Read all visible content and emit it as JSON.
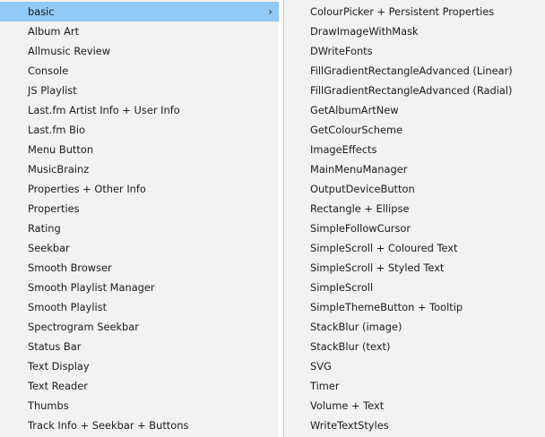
{
  "left_menu": {
    "items": [
      {
        "label": "basic",
        "has_submenu": true,
        "arrow": "›"
      },
      {
        "label": "Album Art"
      },
      {
        "label": "Allmusic Review"
      },
      {
        "label": "Console"
      },
      {
        "label": "JS Playlist"
      },
      {
        "label": "Last.fm Artist Info + User Info"
      },
      {
        "label": "Last.fm Bio"
      },
      {
        "label": "Menu Button"
      },
      {
        "label": "MusicBrainz"
      },
      {
        "label": "Properties + Other Info"
      },
      {
        "label": "Properties"
      },
      {
        "label": "Rating"
      },
      {
        "label": "Seekbar"
      },
      {
        "label": "Smooth Browser"
      },
      {
        "label": "Smooth Playlist Manager"
      },
      {
        "label": "Smooth Playlist"
      },
      {
        "label": "Spectrogram Seekbar"
      },
      {
        "label": "Status Bar"
      },
      {
        "label": "Text Display"
      },
      {
        "label": "Text Reader"
      },
      {
        "label": "Thumbs"
      },
      {
        "label": "Track Info + Seekbar + Buttons"
      }
    ],
    "selected_index": 0
  },
  "right_menu": {
    "items": [
      {
        "label": "ColourPicker + Persistent Properties"
      },
      {
        "label": "DrawImageWithMask"
      },
      {
        "label": "DWriteFonts"
      },
      {
        "label": "FillGradientRectangleAdvanced (Linear)"
      },
      {
        "label": "FillGradientRectangleAdvanced (Radial)"
      },
      {
        "label": "GetAlbumArtNew"
      },
      {
        "label": "GetColourScheme"
      },
      {
        "label": "ImageEffects"
      },
      {
        "label": "MainMenuManager"
      },
      {
        "label": "OutputDeviceButton"
      },
      {
        "label": "Rectangle + Ellipse"
      },
      {
        "label": "SimpleFollowCursor"
      },
      {
        "label": "SimpleScroll + Coloured Text"
      },
      {
        "label": "SimpleScroll + Styled Text"
      },
      {
        "label": "SimpleScroll"
      },
      {
        "label": "SimpleThemeButton + Tooltip"
      },
      {
        "label": "StackBlur (image)"
      },
      {
        "label": "StackBlur (text)"
      },
      {
        "label": "SVG"
      },
      {
        "label": "Timer"
      },
      {
        "label": "Volume + Text"
      },
      {
        "label": "WriteTextStyles"
      }
    ]
  },
  "colors": {
    "menu_background": "#f2f2f2",
    "highlight": "#91c9f7",
    "text": "#1b1b1b",
    "border": "#cccccc"
  },
  "icons": {
    "submenu_arrow": "chevron-right-icon"
  }
}
